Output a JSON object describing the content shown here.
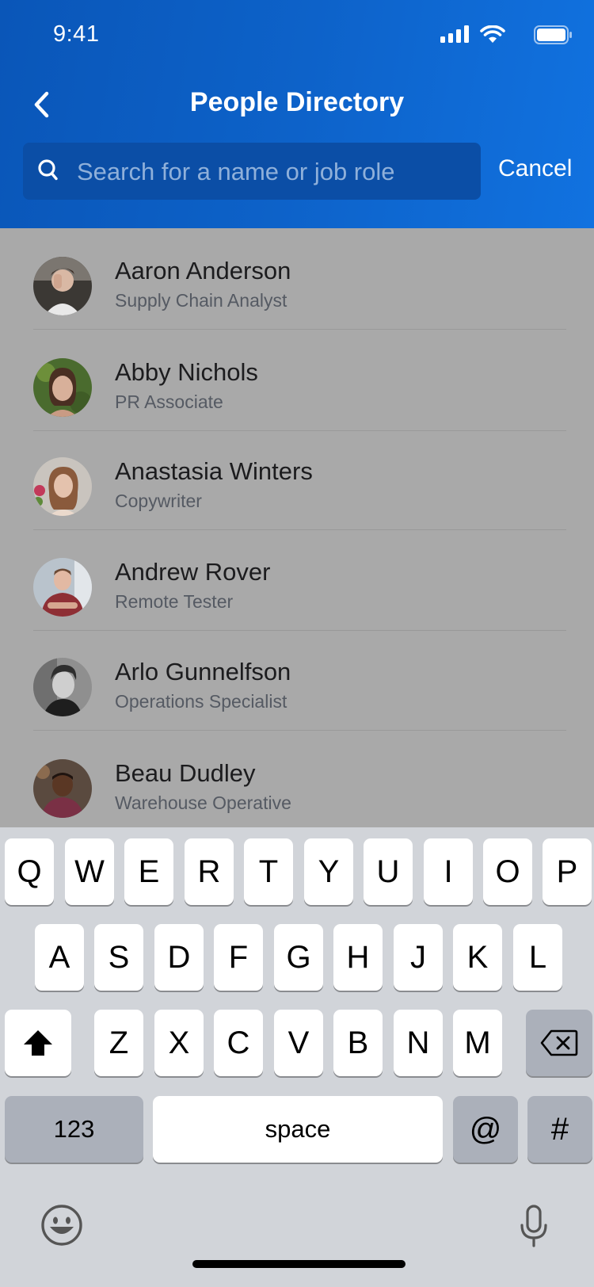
{
  "status_bar": {
    "time": "9:41"
  },
  "header": {
    "title": "People Directory",
    "search_placeholder": "Search for a name or job role",
    "cancel_label": "Cancel"
  },
  "people": [
    {
      "name": "Aaron Anderson",
      "role": "Supply Chain Analyst"
    },
    {
      "name": "Abby Nichols",
      "role": "PR Associate"
    },
    {
      "name": "Anastasia Winters",
      "role": "Copywriter"
    },
    {
      "name": "Andrew Rover",
      "role": "Remote Tester"
    },
    {
      "name": "Arlo Gunnelfson",
      "role": "Operations Specialist"
    },
    {
      "name": "Beau Dudley",
      "role": "Warehouse Operative"
    }
  ],
  "keyboard": {
    "row1": [
      "Q",
      "W",
      "E",
      "R",
      "T",
      "Y",
      "U",
      "I",
      "O",
      "P"
    ],
    "row2": [
      "A",
      "S",
      "D",
      "F",
      "G",
      "H",
      "J",
      "K",
      "L"
    ],
    "row3": [
      "Z",
      "X",
      "C",
      "V",
      "B",
      "N",
      "M"
    ],
    "numbers_label": "123",
    "space_label": "space",
    "at_label": "@",
    "hash_label": "#"
  },
  "icons": {
    "back": "chevron-left-icon",
    "search": "search-icon",
    "shift": "shift-icon",
    "delete": "backspace-icon",
    "emoji": "emoji-icon",
    "mic": "microphone-icon"
  }
}
